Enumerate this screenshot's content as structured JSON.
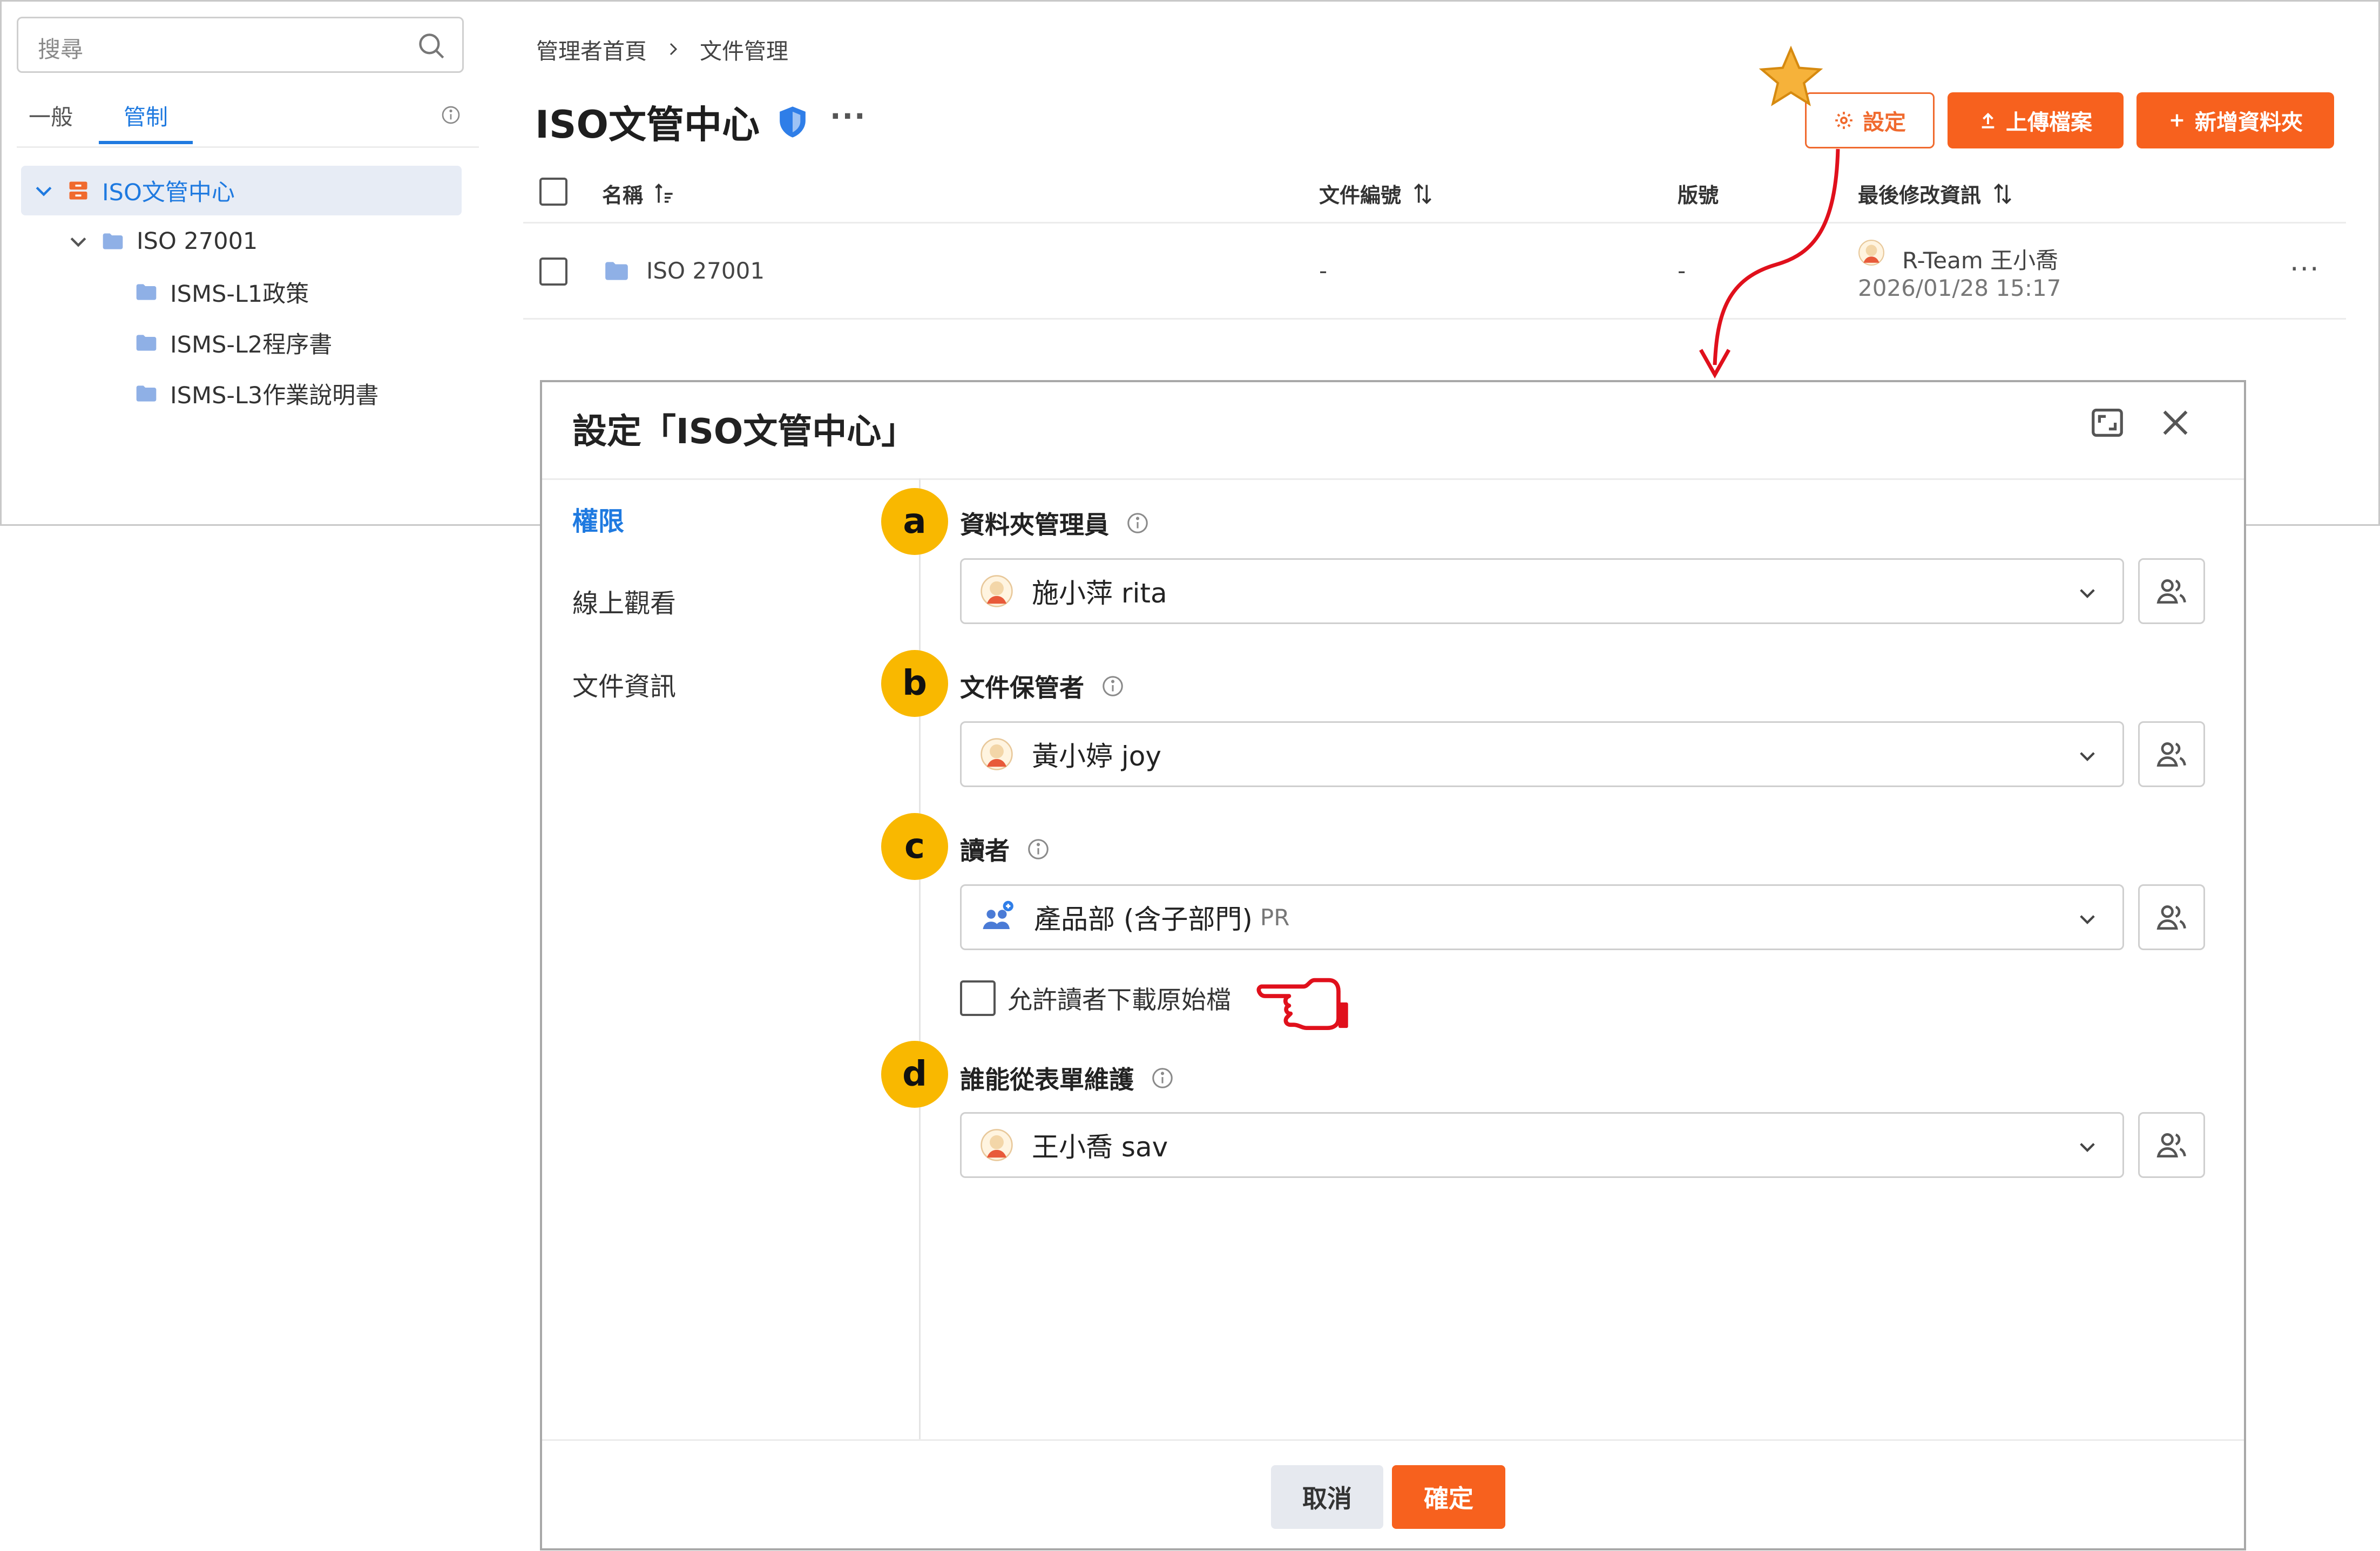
{
  "sidebar": {
    "search_placeholder": "搜尋",
    "tabs": [
      {
        "label": "一般",
        "active": false
      },
      {
        "label": "管制",
        "active": true
      }
    ],
    "tree": [
      {
        "label": "ISO文管中心",
        "selected": true
      },
      {
        "label": "ISO 27001"
      },
      {
        "label": "ISMS-L1政策"
      },
      {
        "label": "ISMS-L2程序書"
      },
      {
        "label": "ISMS-L3作業說明書"
      }
    ]
  },
  "breadcrumb": [
    "管理者首頁",
    "文件管理"
  ],
  "page": {
    "title": "ISO文管中心",
    "actions": {
      "settings": "設定",
      "upload": "上傳檔案",
      "new_folder": "新增資料夾"
    }
  },
  "table": {
    "columns": [
      "名稱",
      "文件編號",
      "版號",
      "最後修改資訊"
    ],
    "rows": [
      {
        "name": "ISO 27001",
        "doc_no": "-",
        "version": "-",
        "modified_by": "R-Team 王小喬",
        "modified_at": "2026/01/28 15:17"
      }
    ]
  },
  "dialog": {
    "title": "設定「ISO文管中心」",
    "menu": [
      "權限",
      "線上觀看",
      "文件資訊"
    ],
    "fields": [
      {
        "marker": "a",
        "label": "資料夾管理員",
        "value": "施小萍  rita",
        "sub": ""
      },
      {
        "marker": "b",
        "label": "文件保管者",
        "value": "黃小婷  joy",
        "sub": ""
      },
      {
        "marker": "c",
        "label": "讀者",
        "value": "產品部 (含子部門)",
        "sub": "PR"
      },
      {
        "marker": "d",
        "label": "誰能從表單維護",
        "value": "王小喬  sav",
        "sub": ""
      }
    ],
    "allow_download_label": "允許讀者下載原始檔",
    "cancel": "取消",
    "confirm": "確定"
  },
  "colors": {
    "accent_orange": "#f7611e",
    "link_blue": "#1f7ae0",
    "marker_yellow": "#f9b800",
    "annotation_red": "#e0101c"
  }
}
